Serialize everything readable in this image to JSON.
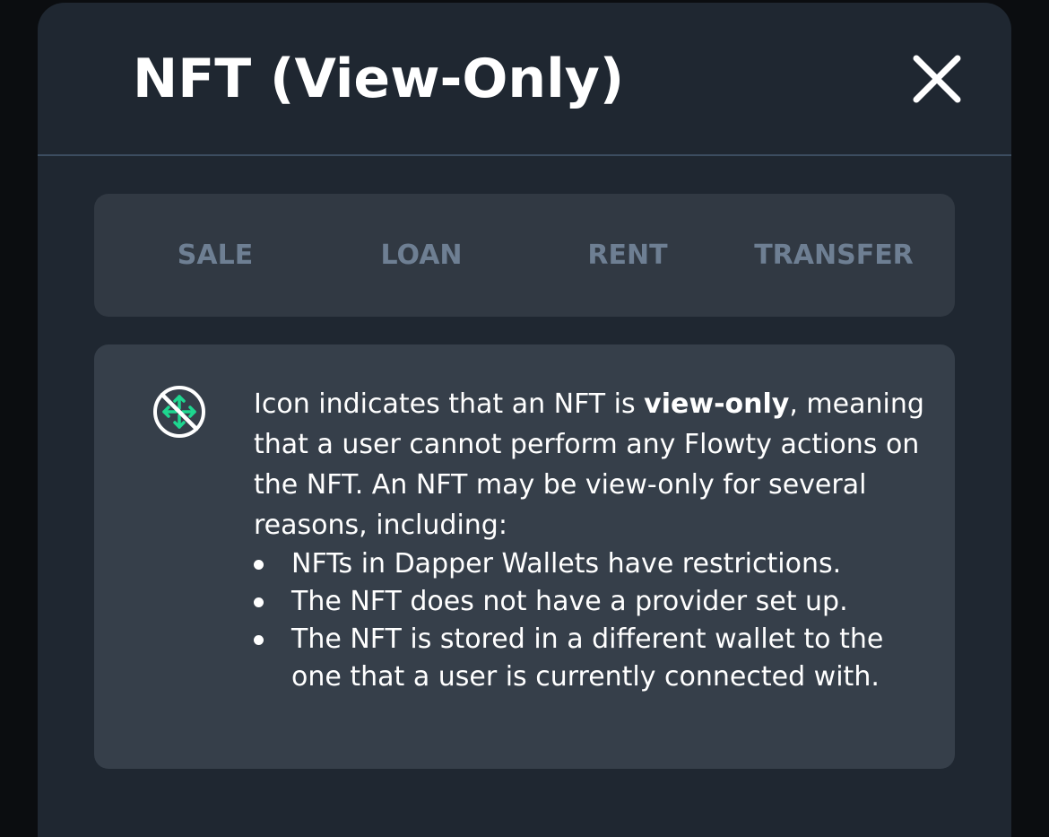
{
  "modal": {
    "title": "NFT (View-Only)",
    "close_icon": "close-icon"
  },
  "tabs": [
    {
      "label": "SALE"
    },
    {
      "label": "LOAN"
    },
    {
      "label": "RENT"
    },
    {
      "label": "TRANSFER"
    }
  ],
  "info": {
    "icon": "view-only-icon",
    "text_before": "Icon indicates that an NFT is ",
    "text_bold": "view-only",
    "text_after": ", meaning that a user cannot perform any Flowty actions on the NFT. An NFT may be view-only for several reasons, including:",
    "reasons": [
      "NFTs in Dapper Wallets have restrictions.",
      "The NFT does not have a provider set up.",
      "The NFT is stored in a different wallet to the one that a user is currently connected with."
    ]
  },
  "colors": {
    "modal_bg": "#1f2731",
    "tabs_bg": "#313943",
    "card_bg": "#363f4a",
    "tab_text": "#6e7f93",
    "accent_green": "#1ed68f",
    "divider": "#3c4d60"
  }
}
